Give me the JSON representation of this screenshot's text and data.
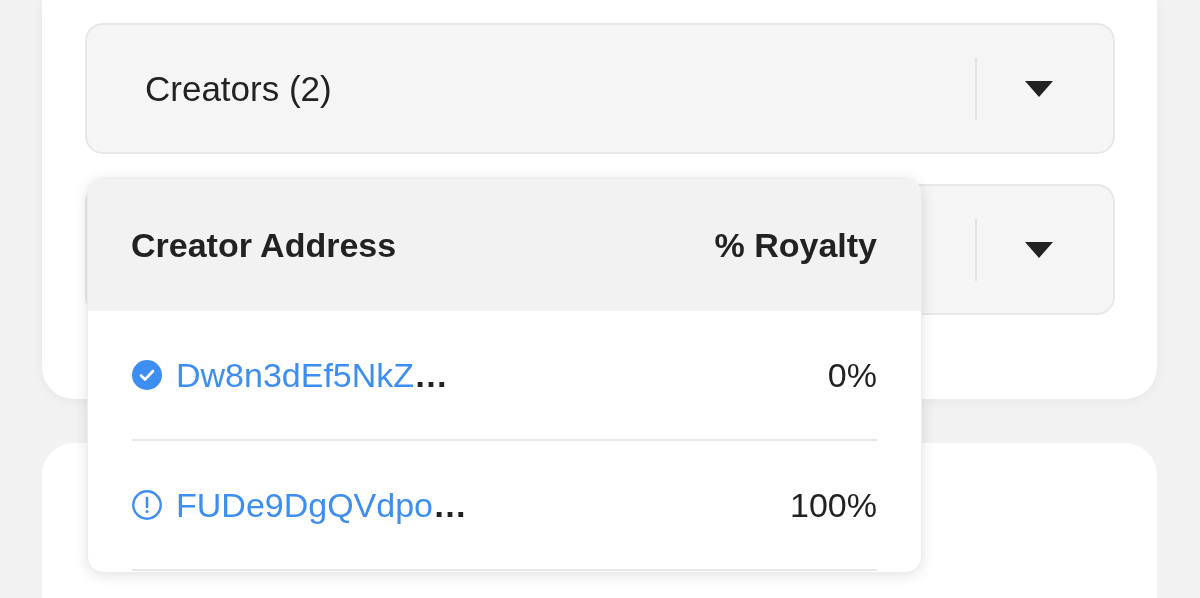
{
  "dropdowns": [
    {
      "kind": "labelled",
      "label": "Creators (2)"
    },
    {
      "kind": "covered"
    }
  ],
  "creators_popup": {
    "columns": [
      "Creator Address",
      "% Royalty"
    ],
    "rows": [
      {
        "address": "Dw8n3dEf5NkZ**…**",
        "verified": true,
        "royalty": "0%"
      },
      {
        "address": "FUDe9DgQVdpo**…**",
        "verified": false,
        "royalty": "100%"
      }
    ]
  }
}
